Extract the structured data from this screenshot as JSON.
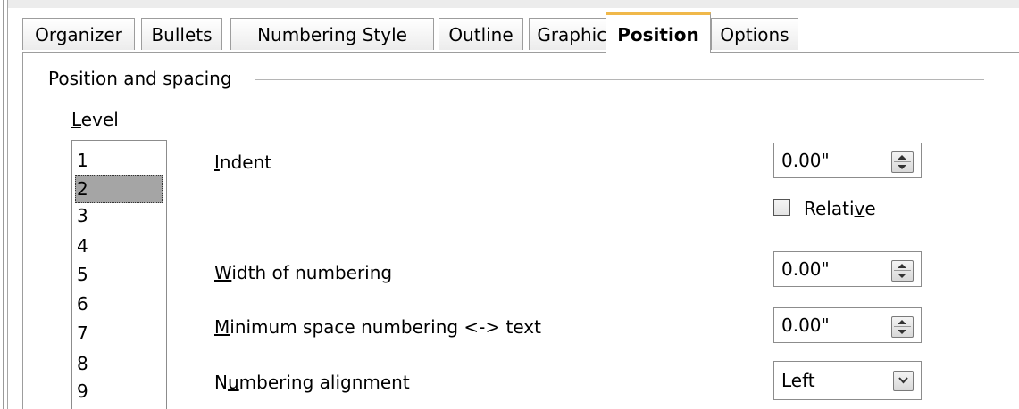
{
  "tabs": [
    {
      "label": "Organizer",
      "active": false
    },
    {
      "label": "Bullets",
      "active": false
    },
    {
      "label": "Numbering Style",
      "active": false
    },
    {
      "label": "Outline",
      "active": false
    },
    {
      "label": "Graphics",
      "active": false
    },
    {
      "label": "Position",
      "active": true
    },
    {
      "label": "Options",
      "active": false
    }
  ],
  "section": {
    "title": "Position and spacing"
  },
  "level": {
    "label_mnemonic": "L",
    "label_rest": "evel",
    "items": [
      "1",
      "2",
      "3",
      "4",
      "5",
      "6",
      "7",
      "8",
      "9"
    ],
    "selected": "2"
  },
  "fields": {
    "indent": {
      "label_mnemonic": "I",
      "label_rest": "ndent",
      "value": "0.00\""
    },
    "relative": {
      "label_pre": "Relati",
      "label_mnemonic": "v",
      "label_post": "e",
      "checked": false
    },
    "width": {
      "label_mnemonic": "W",
      "label_rest": "idth of numbering",
      "value": "0.00\""
    },
    "min_space": {
      "label_mnemonic": "M",
      "label_rest": "inimum space numbering <-> text",
      "value": "0.00\""
    },
    "alignment": {
      "label_pre": "N",
      "label_mnemonic": "u",
      "label_post": "mbering alignment",
      "value": "Left"
    }
  }
}
